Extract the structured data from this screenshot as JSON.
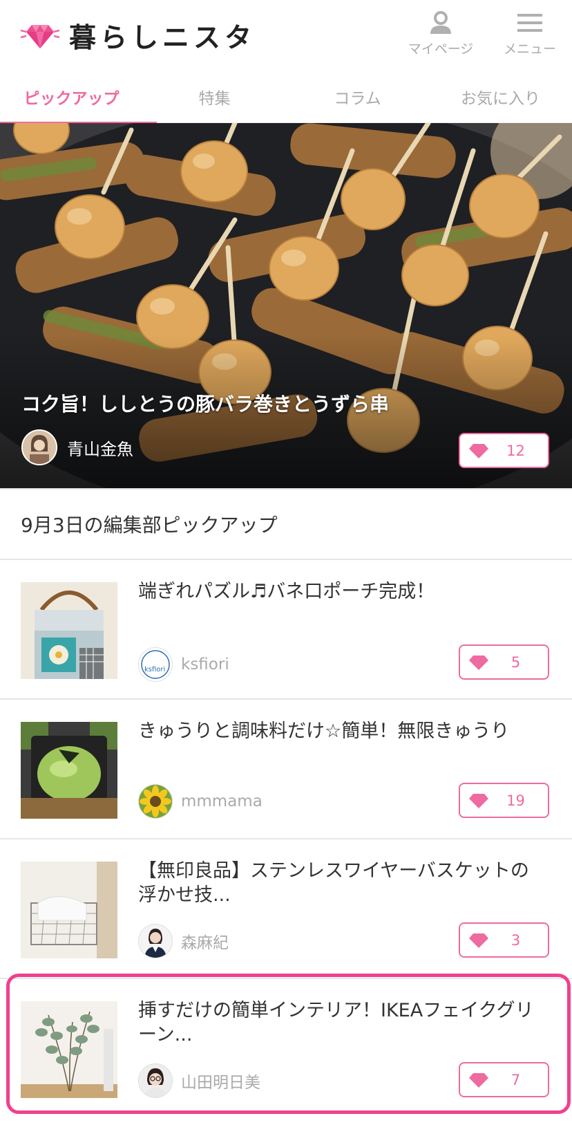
{
  "header": {
    "logo_text": "暮らしニスタ",
    "mypage_label": "マイページ",
    "menu_label": "メニュー"
  },
  "tabs": [
    {
      "label": "ピックアップ",
      "active": true
    },
    {
      "label": "特集",
      "active": false
    },
    {
      "label": "コラム",
      "active": false
    },
    {
      "label": "お気に入り",
      "active": false
    }
  ],
  "hero": {
    "title": "コク旨！ししとうの豚バラ巻きとうずら串",
    "author": "青山金魚",
    "likes": "12"
  },
  "section": {
    "title": "9月3日の編集部ピックアップ"
  },
  "articles": [
    {
      "title": "端ぎれパズル♬バネ口ポーチ完成！",
      "author": "ksfiori",
      "likes": "5"
    },
    {
      "title": "きゅうりと調味料だけ☆簡単！無限きゅうり",
      "author": "mmmama",
      "likes": "19"
    },
    {
      "title": "【無印良品】ステンレスワイヤーバスケットの浮かせ技...",
      "author": "森麻紀",
      "likes": "3"
    },
    {
      "title": "挿すだけの簡単インテリア！IKEAフェイクグリーン...",
      "author": "山田明日美",
      "likes": "7",
      "highlighted": true
    }
  ],
  "colors": {
    "accent": "#ee6aa0",
    "highlight_border": "#f0408f",
    "muted_text": "#aaaaaa"
  }
}
